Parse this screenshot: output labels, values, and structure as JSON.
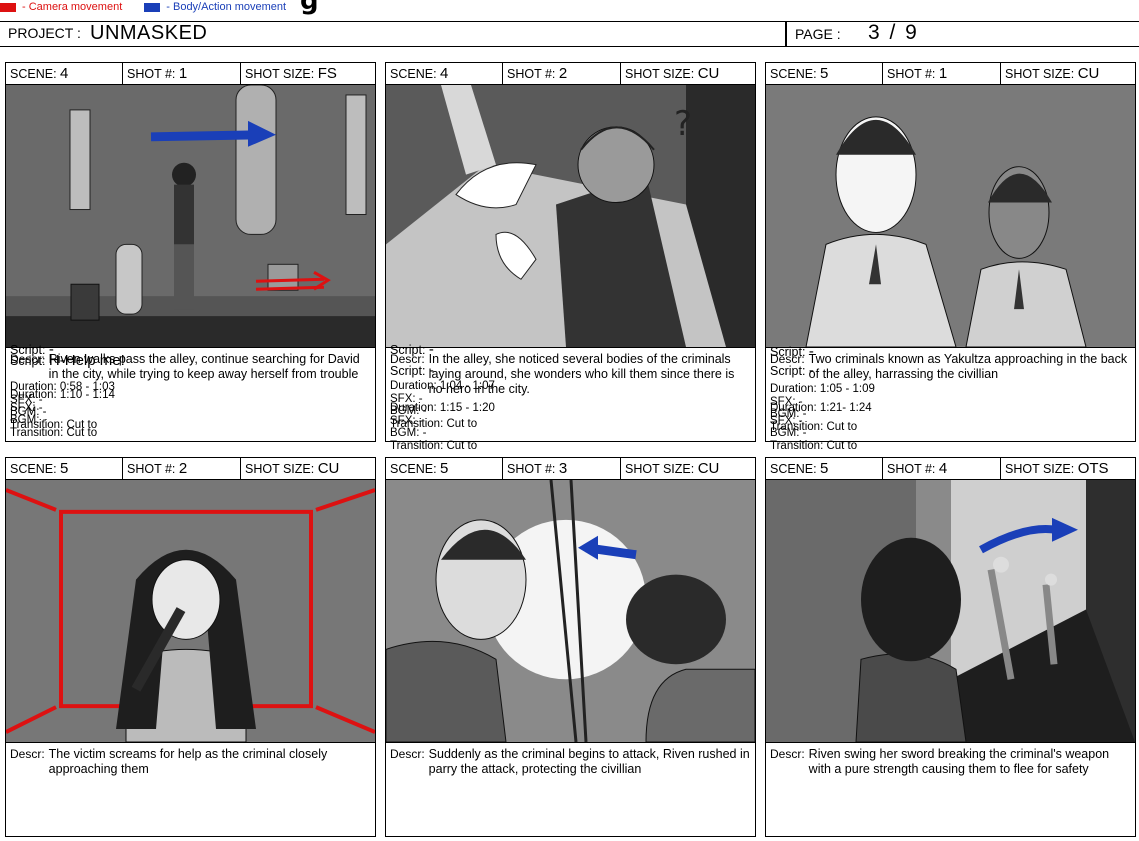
{
  "legend": {
    "camera_label": "- Camera movement",
    "body_label": "- Body/Action movement",
    "camera_color": "#dd1111",
    "body_color": "#1a3fb8"
  },
  "header": {
    "project_label": "PROJECT :",
    "project_name": "UNMASKED",
    "page_label": "PAGE :",
    "page_number": "3 / 9"
  },
  "meta_labels": {
    "scene": "SCENE:",
    "shot": "SHOT #:",
    "size": "SHOT SIZE:",
    "descr": "Descr:",
    "script": "Script:",
    "duration": "Duration:",
    "sfx": "SFX:",
    "bgm": "BGM:",
    "transition": "Transition:"
  },
  "panels": [
    {
      "scene": "4",
      "shot": "1",
      "size": "FS",
      "descr": "Riven walks pass the alley, continue searching for David in the city, while trying to keep away herself from trouble",
      "script": "-",
      "duration": "0:58 - 1:03",
      "sfx": "-",
      "bgm": "-",
      "transition": "Cut to"
    },
    {
      "scene": "4",
      "shot": "2",
      "size": "CU",
      "descr": "In the alley, she noticed several bodies of the criminals laying around, she wonders who kill them since there is no hero in the city.",
      "script": "-",
      "duration": "1:04 - 1:07",
      "sfx": "-",
      "bgm": "-",
      "transition": "Cut to"
    },
    {
      "scene": "5",
      "shot": "1",
      "size": "CU",
      "descr": "Two criminals known as Yakultza approaching in the back of the alley, harrassing the civillian",
      "script": "-",
      "duration": "1:05 - 1:09",
      "sfx": "-",
      "bgm": "-",
      "transition": "Cut to"
    },
    {
      "scene": "5",
      "shot": "2",
      "size": "CU",
      "descr": "The victim screams for help as the criminal closely approaching them",
      "script": "H-Help me!",
      "duration": "1:10 - 1:14",
      "sfx": "-",
      "bgm": "-",
      "transition": "Cut to"
    },
    {
      "scene": "5",
      "shot": "3",
      "size": "CU",
      "descr": "Suddenly as the criminal begins to attack, Riven rushed in parry the attack, protecting the civillian",
      "script": "-",
      "duration": "1:15 - 1:20",
      "sfx": "-",
      "bgm": "-",
      "transition": "Cut to"
    },
    {
      "scene": "5",
      "shot": "4",
      "size": "OTS",
      "descr": "Riven swing her sword breaking the criminal's weapon with a pure strength causing them to flee for safety",
      "script": "-",
      "duration": "1:21- 1:24",
      "sfx": "-",
      "bgm": "-",
      "transition": "Cut to"
    }
  ]
}
